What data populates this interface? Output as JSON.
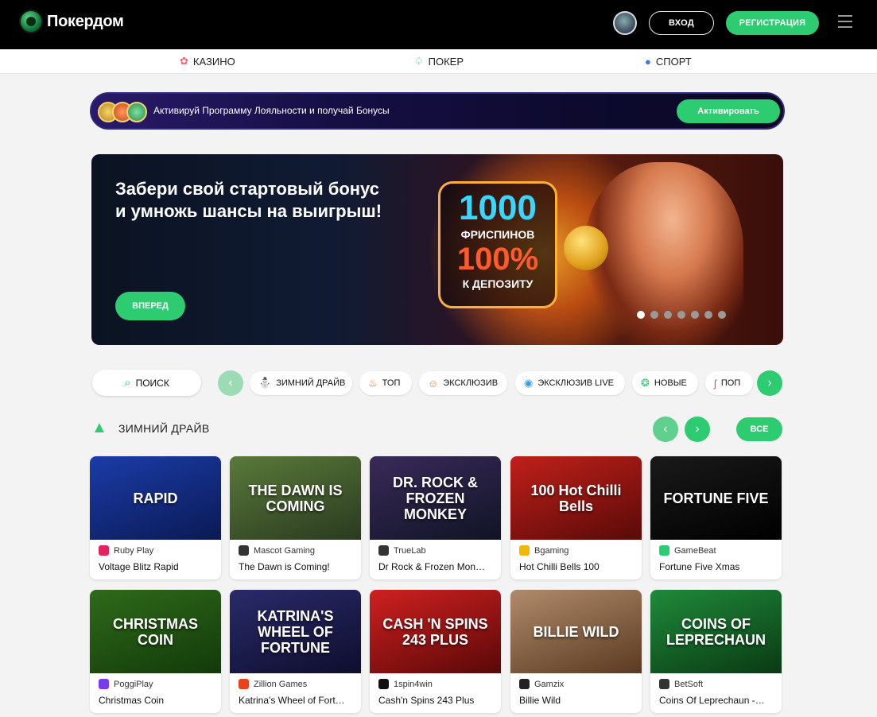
{
  "header": {
    "logo_text": "Покердом",
    "login_label": "ВХОД",
    "register_label": "РЕГИСТРАЦИЯ"
  },
  "nav": {
    "items": [
      {
        "label": "КАЗИНО",
        "icon": "casino-icon"
      },
      {
        "label": "ПОКЕР",
        "icon": "spade-icon"
      },
      {
        "label": "СПОРТ",
        "icon": "ball-icon"
      }
    ]
  },
  "loyalty": {
    "text": "Активируй Программу Лояльности и получай Бонусы",
    "button": "Активировать"
  },
  "hero": {
    "title_line1": "Забери свой стартовый бонус",
    "title_line2": "и умножь шансы на выигрыш!",
    "offer_number": "1000",
    "offer_line1": "ФРИСПИНОВ",
    "offer_percent": "100%",
    "offer_line2": "К ДЕПОЗИТУ",
    "button": "ВПЕРЕД",
    "slides_total": 7,
    "slide_active": 1
  },
  "categories": {
    "search_label": "ПОИСК",
    "items": [
      {
        "label": "ЗИМНИЙ ДРАЙВ",
        "icon": "tree-icon"
      },
      {
        "label": "ТОП",
        "icon": "fire-icon"
      },
      {
        "label": "ЭКСКЛЮЗИВ",
        "icon": "face-icon"
      },
      {
        "label": "ЭКСКЛЮЗИВ LIVE",
        "icon": "live-icon"
      },
      {
        "label": "НОВЫЕ",
        "icon": "new-icon"
      },
      {
        "label": "ПОП",
        "icon": "pepper-icon"
      }
    ]
  },
  "section": {
    "title": "ЗИМНИЙ ДРАЙВ",
    "all_label": "ВСЕ"
  },
  "games": [
    {
      "provider": "Ruby Play",
      "name": "Voltage Blitz Rapid",
      "thumb_title": "RAPID",
      "colors": [
        "#1b3ca8",
        "#0b1a55"
      ],
      "prov_color": "#e0245e"
    },
    {
      "provider": "Mascot Gaming",
      "name": "The Dawn is Coming!",
      "thumb_title": "THE DAWN IS COMING",
      "colors": [
        "#5a7a3a",
        "#2a3a20"
      ],
      "prov_color": "#333333"
    },
    {
      "provider": "TrueLab",
      "name": "Dr Rock & Frozen Mon…",
      "thumb_title": "DR. ROCK & FROZEN MONKEY",
      "colors": [
        "#3a2a5a",
        "#101425"
      ],
      "prov_color": "#333333"
    },
    {
      "provider": "Bgaming",
      "name": "Hot Chilli Bells 100",
      "thumb_title": "100 Hot Chilli Bells",
      "colors": [
        "#c0201a",
        "#5a0a08"
      ],
      "prov_color": "#f2b705"
    },
    {
      "provider": "GameBeat",
      "name": "Fortune Five Xmas",
      "thumb_title": "FORTUNE FIVE",
      "colors": [
        "#1a1a1a",
        "#000000"
      ],
      "prov_color": "#2ecc71"
    },
    {
      "provider": "PoggiPlay",
      "name": "Christmas Coin",
      "thumb_title": "CHRISTMAS COIN",
      "colors": [
        "#2f6a1a",
        "#123a0a"
      ],
      "prov_color": "#7a3af0"
    },
    {
      "provider": "Zillion Games",
      "name": "Katrina's Wheel of Fort…",
      "thumb_title": "KATRINA'S WHEEL OF FORTUNE",
      "colors": [
        "#2a2a6a",
        "#0e0e2e"
      ],
      "prov_color": "#e8431a"
    },
    {
      "provider": "1spin4win",
      "name": "Cash'n Spins 243 Plus",
      "thumb_title": "CASH 'N SPINS 243 PLUS",
      "colors": [
        "#d02020",
        "#5a0808"
      ],
      "prov_color": "#111111"
    },
    {
      "provider": "Gamzix",
      "name": "Billie Wild",
      "thumb_title": "BILLIE WILD",
      "colors": [
        "#b08a6a",
        "#5a3a22"
      ],
      "prov_color": "#222222"
    },
    {
      "provider": "BetSoft",
      "name": "Coins Of Leprechaun -…",
      "thumb_title": "COINS OF LEPRECHAUN",
      "colors": [
        "#1f8a3a",
        "#0a3a14"
      ],
      "prov_color": "#333333"
    }
  ]
}
